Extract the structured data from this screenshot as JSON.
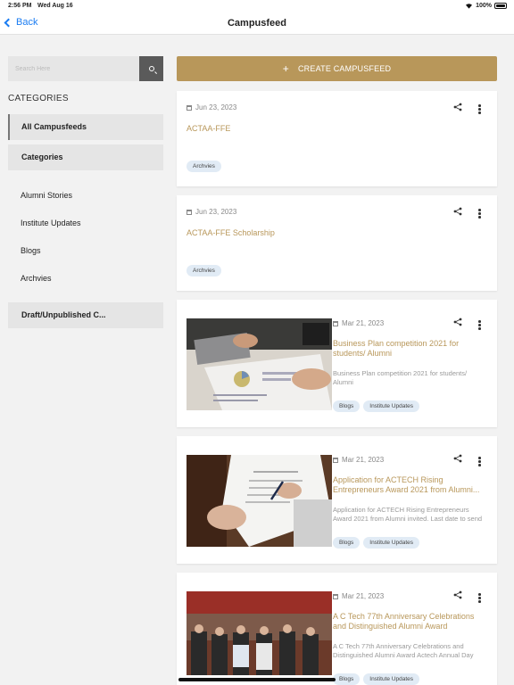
{
  "status_bar": {
    "time": "2:56 PM",
    "date": "Wed Aug 16",
    "battery": "100%"
  },
  "nav": {
    "back_label": "Back",
    "title": "Campusfeed"
  },
  "search": {
    "placeholder": "Search Here"
  },
  "sidebar": {
    "heading": "CATEGORIES",
    "buttons": [
      {
        "label": "All Campusfeeds"
      },
      {
        "label": "Categories"
      }
    ],
    "links": [
      {
        "label": "Alumni Stories"
      },
      {
        "label": "Institute Updates"
      },
      {
        "label": "Blogs"
      },
      {
        "label": "Archvies"
      }
    ],
    "draft_label": "Draft/Unpublished C..."
  },
  "create_button": {
    "plus": "+",
    "label": "CREATE CAMPUSFEED"
  },
  "feed": [
    {
      "date": "Jun 23, 2023",
      "title": "ACTAA-FFE",
      "tags": [
        "Archvies"
      ]
    },
    {
      "date": "Jun 23, 2023",
      "title": "ACTAA-FFE Scholarship",
      "tags": [
        "Archvies"
      ]
    },
    {
      "date": "Mar 21, 2023",
      "title": "Business Plan competition 2021 for students/ Alumni",
      "desc": "Business Plan competition 2021 for students/ Alumni",
      "tags": [
        "Blogs",
        "Institute Updates"
      ]
    },
    {
      "date": "Mar 21, 2023",
      "title": "Application for ACTECH Rising Entrepreneurs Award 2021 from Alumni...",
      "desc": "Application for ACTECH Rising Entrepreneurs Award 2021 from Alumni invited. Last date to send ?...",
      "tags": [
        "Blogs",
        "Institute Updates"
      ]
    },
    {
      "date": "Mar 21, 2023",
      "title": "A C Tech 77th Anniversary Celebrations and Distinguished Alumni Award",
      "desc": "A C Tech 77th Anniversary Celebrations and Distinguished Alumni Award Actech Annual Day Celeb...",
      "tags": [
        "Blogs",
        "Institute Updates"
      ]
    }
  ],
  "colors": {
    "accent": "#b8975a",
    "link_blue": "#1a7cf2",
    "tag_bg": "#e1ebf5"
  }
}
